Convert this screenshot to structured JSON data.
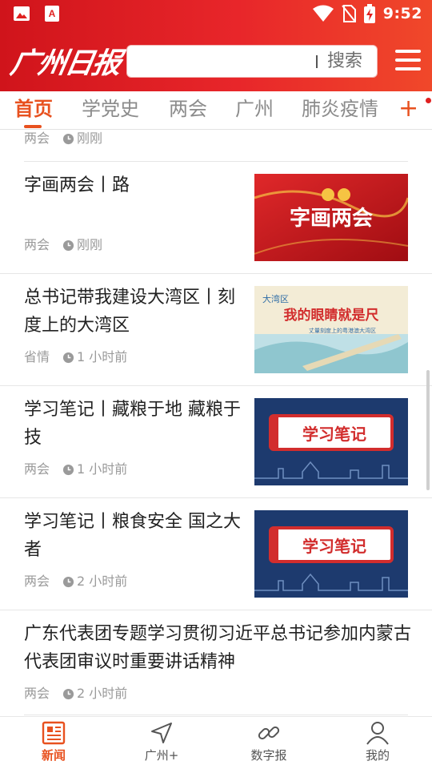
{
  "status_bar": {
    "time": "9:52",
    "left_icons": [
      "image-icon",
      "pdf-icon"
    ],
    "right_icons": [
      "wifi-icon",
      "no-sim-icon",
      "battery-charging-icon"
    ]
  },
  "header": {
    "logo_text": "广州日报",
    "search_button": "搜索"
  },
  "tabs": {
    "items": [
      "首页",
      "学党史",
      "两会",
      "广州",
      "肺炎疫情"
    ],
    "active": "首页",
    "plus": "+"
  },
  "feed": {
    "partial_item": {
      "source": "两会",
      "time": "刚刚"
    },
    "items": [
      {
        "title": "字画两会丨路",
        "source": "两会",
        "time": "刚刚",
        "thumb_text": "字画两会"
      },
      {
        "title": "总书记带我建设大湾区丨刻度上的大湾区",
        "source": "省情",
        "time": "1 小时前",
        "thumb_text": "我的眼睛就是尺",
        "thumb_sub": "丈量刻度上的粤港澳大湾区"
      },
      {
        "title": "学习笔记丨藏粮于地 藏粮于技",
        "source": "两会",
        "time": "1 小时前",
        "thumb_text": "学习笔记"
      },
      {
        "title": "学习笔记丨粮食安全 国之大者",
        "source": "两会",
        "time": "2 小时前",
        "thumb_text": "学习笔记"
      },
      {
        "title": "广东代表团专题学习贯彻习近平总书记参加内蒙古代表团审议时重要讲话精神",
        "source": "两会",
        "time": "2 小时前"
      }
    ]
  },
  "bottom_nav": {
    "items": [
      "新闻",
      "广州+",
      "数字报",
      "我的"
    ],
    "active": "新闻"
  },
  "colors": {
    "header_red": "#e0201f",
    "accent_orange": "#e8511f",
    "thumb_navy": "#1d3a6e"
  }
}
